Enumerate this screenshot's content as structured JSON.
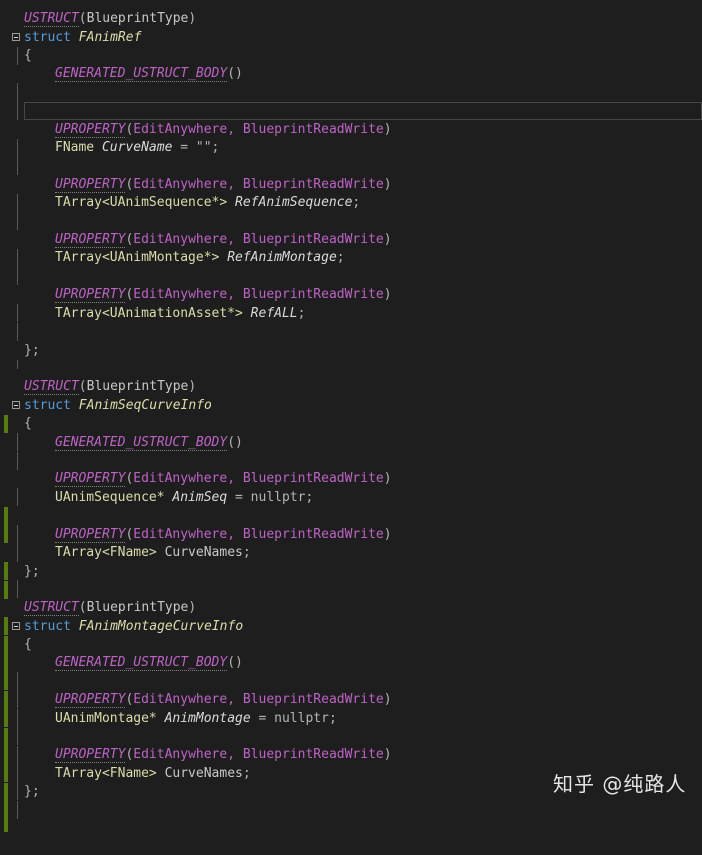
{
  "code": {
    "uproperty_args": "EditAnywhere, BlueprintReadWrite",
    "ustruct_macro": "USTRUCT",
    "ustruct_arg": "BlueprintType",
    "struct_keyword": "struct",
    "generated_body": "GENERATED_USTRUCT_BODY",
    "uproperty_macro": "UPROPERTY",
    "structs": [
      {
        "name": "FAnimRef",
        "fields": [
          {
            "type": "FName",
            "name": "CurveName",
            "suffix": " = \"\";"
          },
          {
            "type": "TArray<UAnimSequence*>",
            "name": "RefAnimSequence",
            "suffix": ";"
          },
          {
            "type": "TArray<UAnimMontage*>",
            "name": "RefAnimMontage",
            "suffix": ";"
          },
          {
            "type": "TArray<UAnimationAsset*>",
            "name": "RefALL",
            "suffix": ";"
          }
        ]
      },
      {
        "name": "FAnimSeqCurveInfo",
        "fields": [
          {
            "type": "UAnimSequence*",
            "name": "AnimSeq",
            "suffix": " = nullptr;"
          },
          {
            "type": "TArray<FName>",
            "name": "CurveNames",
            "suffix": ";"
          }
        ]
      },
      {
        "name": "FAnimMontageCurveInfo",
        "fields": [
          {
            "type": "UAnimMontage*",
            "name": "AnimMontage",
            "suffix": " = nullptr;"
          },
          {
            "type": "TArray<FName>",
            "name": "CurveNames",
            "suffix": ";"
          }
        ]
      }
    ]
  },
  "watermark": "知乎 @纯路人",
  "colors": {
    "background": "#1e1e1e",
    "macro": "#bd63c5",
    "keyword": "#569cd6",
    "type": "#4ec9b0",
    "user_type": "#dcdcaa",
    "member": "#dadada",
    "punct": "#b4b4b4",
    "string": "#d69d85",
    "change_bar": "#587c0c"
  }
}
